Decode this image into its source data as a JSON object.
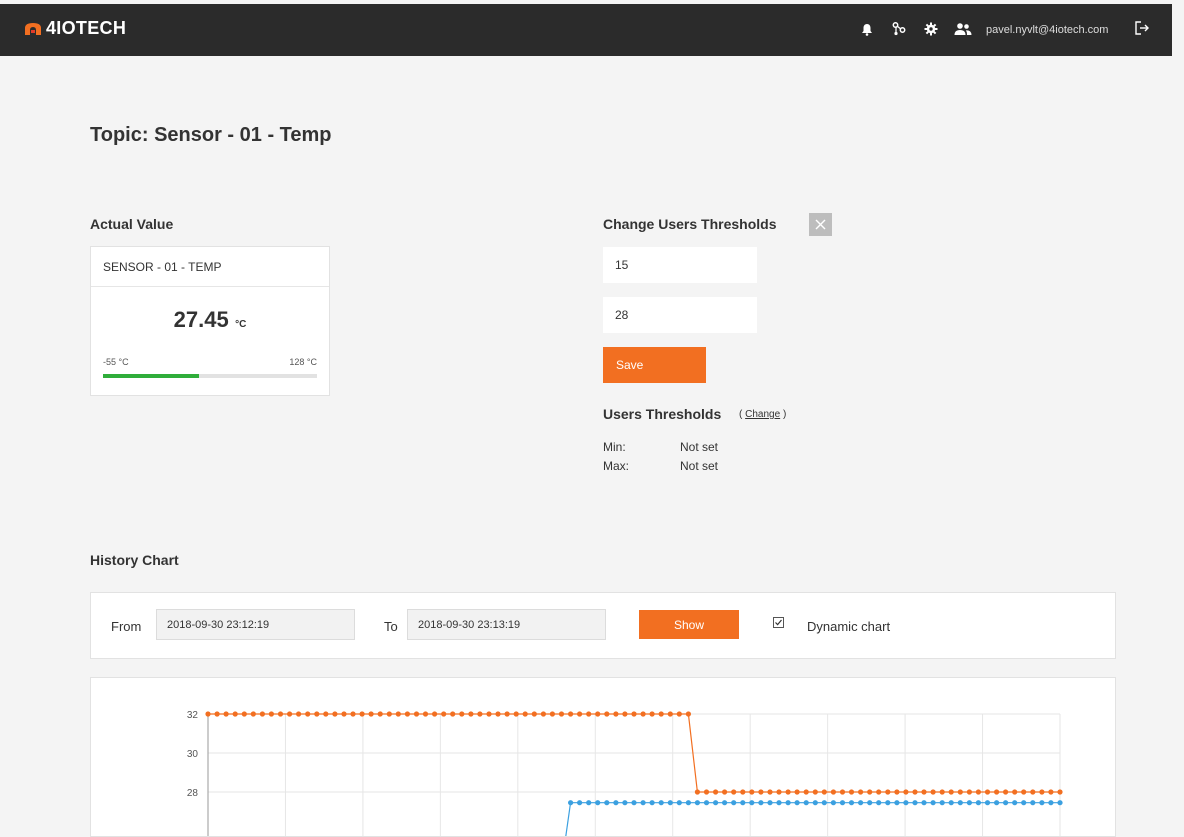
{
  "header": {
    "logo_text": "4IOTECH",
    "icons": [
      "bell-icon",
      "share-icon",
      "gear-icon",
      "users-icon"
    ],
    "user_email": "pavel.nyvlt@4iotech.com",
    "logout_icon": "logout-icon"
  },
  "page": {
    "title": "Topic: Sensor - 01 - Temp"
  },
  "actual_value": {
    "section_title": "Actual Value",
    "card_title": "SENSOR - 01 - TEMP",
    "value": "27.45",
    "unit": "°C",
    "range_min": "-55 °C",
    "range_max": "128 °C",
    "fill_fraction": 0.45,
    "bar_color": "#2fad3a"
  },
  "change_thresholds": {
    "title": "Change Users Thresholds",
    "min_value": "15",
    "max_value": "28",
    "save_label": "Save"
  },
  "users_thresholds": {
    "title": "Users Thresholds",
    "change_open": "(",
    "change_label": "Change",
    "change_close": ")",
    "min_label": "Min:",
    "min_value": "Not set",
    "max_label": "Max:",
    "max_value": "Not set"
  },
  "history": {
    "title": "History Chart",
    "from_label": "From",
    "from_value": "2018-09-30 23:12:19",
    "to_label": "To",
    "to_value": "2018-09-30 23:13:19",
    "show_label": "Show",
    "dynamic_label": "Dynamic chart",
    "dynamic_checked": true
  },
  "colors": {
    "accent": "#f26f21",
    "topbar": "#2b2b2b",
    "series_orange": "#f26f21",
    "series_blue": "#3ba0e0"
  },
  "chart_data": {
    "type": "line",
    "y_ticks": [
      "32",
      "30",
      "28"
    ],
    "ylim": [
      26,
      33
    ],
    "grid": true,
    "series": [
      {
        "color": "#f26f21",
        "x_index": [
          0,
          1,
          2,
          3,
          4,
          5,
          6,
          7,
          8,
          9,
          10,
          11,
          12,
          13,
          14,
          15,
          16,
          17,
          18,
          19,
          20,
          21,
          22,
          23,
          24,
          25,
          26,
          27,
          28,
          29,
          30,
          31,
          32,
          33,
          34,
          35,
          36,
          37,
          38,
          39,
          40,
          41,
          42,
          43,
          44,
          45,
          46,
          47,
          48,
          49,
          50,
          51,
          52,
          53,
          54,
          55,
          56,
          57,
          58,
          59,
          60,
          61,
          62,
          63,
          64,
          65,
          66,
          67,
          68,
          69,
          70,
          71,
          72,
          73,
          74,
          75,
          76,
          77,
          78,
          79,
          80,
          81,
          82,
          83,
          84,
          85,
          86,
          87,
          88,
          89,
          90,
          91,
          92,
          93,
          94
        ],
        "values": [
          32,
          32,
          32,
          32,
          32,
          32,
          32,
          32,
          32,
          32,
          32,
          32,
          32,
          32,
          32,
          32,
          32,
          32,
          32,
          32,
          32,
          32,
          32,
          32,
          32,
          32,
          32,
          32,
          32,
          32,
          32,
          32,
          32,
          32,
          32,
          32,
          32,
          32,
          32,
          32,
          32,
          32,
          32,
          32,
          32,
          32,
          32,
          32,
          32,
          32,
          32,
          32,
          32,
          32,
          28,
          28,
          28,
          28,
          28,
          28,
          28,
          28,
          28,
          28,
          28,
          28,
          28,
          28,
          28,
          28,
          28,
          28,
          28,
          28,
          28,
          28,
          28,
          28,
          28,
          28,
          28,
          28,
          28,
          28,
          28,
          28,
          28,
          28,
          28,
          28,
          28,
          28,
          28,
          28,
          28
        ]
      },
      {
        "color": "#3ba0e0",
        "x_index": [
          40,
          41,
          42,
          43,
          44,
          45,
          46,
          47,
          48,
          49,
          50,
          51,
          52,
          53,
          54,
          55,
          56,
          57,
          58,
          59,
          60,
          61,
          62,
          63,
          64,
          65,
          66,
          67,
          68,
          69,
          70,
          71,
          72,
          73,
          74,
          75,
          76,
          77,
          78,
          79,
          80,
          81,
          82,
          83,
          84,
          85,
          86,
          87,
          88,
          89,
          90,
          91,
          92,
          93,
          94
        ],
        "values": [
          27.45,
          27.45,
          27.45,
          27.45,
          27.45,
          27.45,
          27.45,
          27.45,
          27.45,
          27.45,
          27.45,
          27.45,
          27.45,
          27.45,
          27.45,
          27.45,
          27.45,
          27.45,
          27.45,
          27.45,
          27.45,
          27.45,
          27.45,
          27.45,
          27.45,
          27.45,
          27.45,
          27.45,
          27.45,
          27.45,
          27.45,
          27.45,
          27.45,
          27.45,
          27.45,
          27.45,
          27.45,
          27.45,
          27.45,
          27.45,
          27.45,
          27.45,
          27.45,
          27.45,
          27.45,
          27.45,
          27.45,
          27.45,
          27.45,
          27.45,
          27.45,
          27.45,
          27.45,
          27.45,
          27.45
        ]
      }
    ]
  }
}
